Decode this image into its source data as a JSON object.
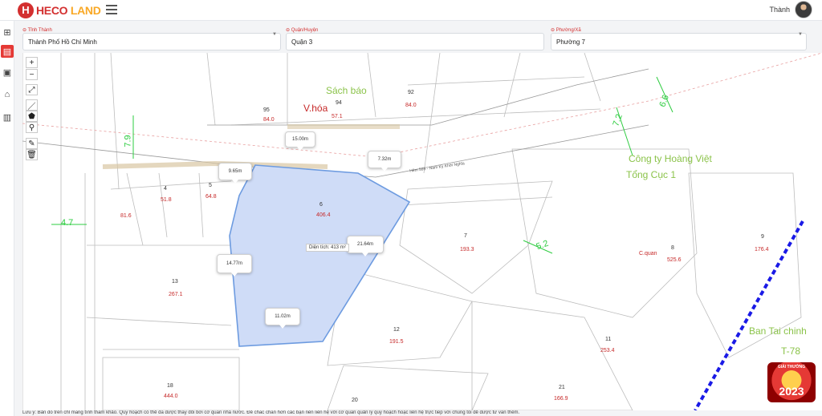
{
  "header": {
    "logo_mark": "H",
    "logo_heco": "HECO",
    "logo_land": "LAND",
    "user_name": "Thành"
  },
  "sidebar": {
    "items": [
      {
        "name": "grid-icon",
        "glyph": "⊞"
      },
      {
        "name": "map-icon",
        "glyph": "▤"
      },
      {
        "name": "inbox-icon",
        "glyph": "▣"
      },
      {
        "name": "buildings-icon",
        "glyph": "⌂"
      },
      {
        "name": "document-icon",
        "glyph": "▥"
      }
    ]
  },
  "filters": {
    "province": {
      "label": "Tỉnh Thành",
      "value": "Thành Phố Hồ Chí Minh"
    },
    "district": {
      "label": "Quận/Huyện",
      "value": "Quận 3"
    },
    "ward": {
      "label": "Phường/Xã",
      "value": "Phường 7"
    }
  },
  "map": {
    "selected_parcel": {
      "number": "6",
      "area": "406.4",
      "area_label": "Diện tích: 413 m²"
    },
    "measurements": [
      "15.00m",
      "9.65m",
      "7.32m",
      "21.64m",
      "14.77m",
      "11.02m"
    ],
    "road_widths": [
      "7.9",
      "7.2",
      "6.6",
      "4.7",
      "5.2"
    ],
    "road_name": "Hẻm 595 - Nam Kỳ Khởi Nghĩa",
    "parcels": [
      {
        "no": "95",
        "area": "84.0"
      },
      {
        "no": "94",
        "area": "57.1"
      },
      {
        "no": "92",
        "area": "84.0"
      },
      {
        "no": "5",
        "area": "64.8"
      },
      {
        "no": "4",
        "area": "51.8"
      },
      {
        "no": "",
        "area": "81.6"
      },
      {
        "no": "7",
        "area": "193.3"
      },
      {
        "no": "8",
        "area": "525.6"
      },
      {
        "no": "9",
        "area": "176.4"
      },
      {
        "no": "13",
        "area": "267.1"
      },
      {
        "no": "12",
        "area": "191.5"
      },
      {
        "no": "11",
        "area": "253.4"
      },
      {
        "no": "18",
        "area": "444.0"
      },
      {
        "no": "21",
        "area": "166.9"
      },
      {
        "no": "20",
        "area": ""
      }
    ],
    "place_labels": [
      "Sách báo",
      "V.hóa",
      "Công ty Hoàng Việt",
      "Tổng Cục 1",
      "Ban Tai chinh",
      "T-78",
      "C.quan"
    ],
    "badge_top": "GIẢI THƯỞNG",
    "badge_year": "2023"
  },
  "footer": {
    "disclaimer": "Lưu ý: Bản đồ trên chỉ mang tính tham khảo. Quy hoạch có thể đã được thay đổi bởi cơ quan nhà nước. Để chắc chắn hơn các bạn nên liên hệ với cơ quan quản lý quy hoạch hoặc liên hệ trực tiếp với chúng tôi để được tư vấn thêm."
  },
  "colors": {
    "brand": "#d32f2f",
    "parcel_fill": "#cfdcf7",
    "parcel_stroke": "#6d9be0",
    "road_green": "#2ecc40",
    "label_red": "#c62828"
  }
}
